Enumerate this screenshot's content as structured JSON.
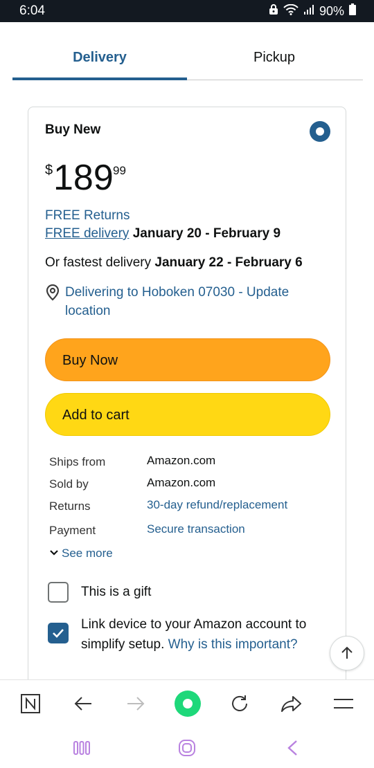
{
  "status_bar": {
    "time": "6:04",
    "battery": "90%",
    "icons": [
      "lock-icon",
      "wifi-icon",
      "signal-icon",
      "battery-icon"
    ]
  },
  "tabs": [
    {
      "label": "Delivery",
      "selected": true
    },
    {
      "label": "Pickup",
      "selected": false
    }
  ],
  "offer": {
    "heading": "Buy New",
    "selected": true,
    "price_symbol": "$",
    "price_whole": "189",
    "price_fraction": "99",
    "free_returns": "FREE Returns",
    "free_delivery_link": "FREE delivery",
    "delivery_dates": "January 20 - February 9",
    "fastest_prefix": "Or fastest delivery",
    "fastest_dates": "January 22 - February 6",
    "location_text": "Delivering to Hoboken 07030 - Update location",
    "buy_now": "Buy Now",
    "add_to_cart": "Add to cart"
  },
  "details": [
    {
      "label": "Ships from",
      "value": "Amazon.com",
      "is_link": false
    },
    {
      "label": "Sold by",
      "value": "Amazon.com",
      "is_link": false
    },
    {
      "label": "Returns",
      "value": "30-day refund/replacement",
      "is_link": true
    },
    {
      "label": "Payment",
      "value": "Secure transaction",
      "is_link": true
    }
  ],
  "see_more": "See more",
  "options": {
    "gift_label": "This is a gift",
    "gift_checked": false,
    "link_device_text": "Link device to your Amazon account to simplify setup.",
    "link_device_link": "Why is this important?",
    "link_device_checked": true
  },
  "toolbar_icons": [
    "tabs-n-icon",
    "back-arrow-icon",
    "forward-arrow-icon",
    "home-circle-icon",
    "reload-icon",
    "share-icon",
    "menu-icon"
  ],
  "nav_icons": [
    "recent-apps-icon",
    "home-icon",
    "back-icon"
  ],
  "colors": {
    "accent_link": "#245f8f",
    "buy_now": "#ffa41c",
    "add_to_cart": "#ffd814",
    "status_bar_bg": "#131921"
  }
}
